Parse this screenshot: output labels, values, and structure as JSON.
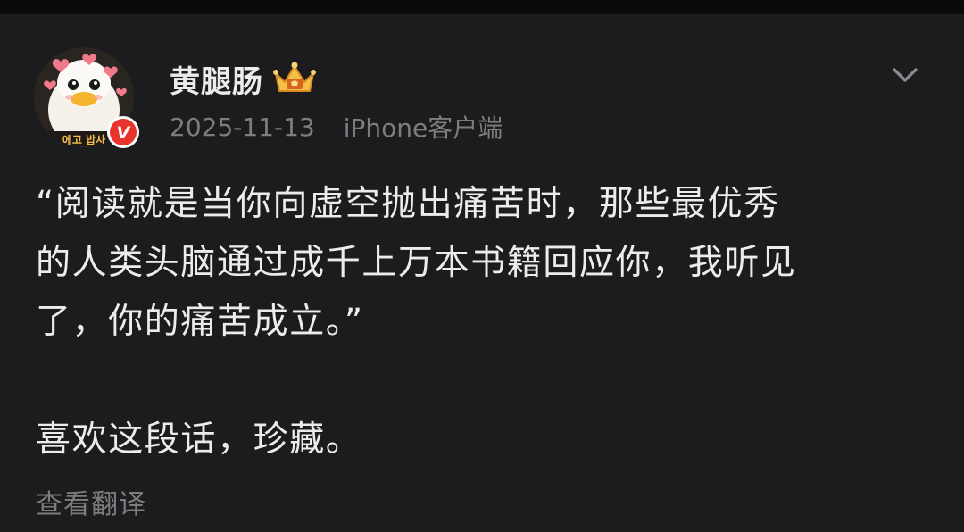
{
  "post": {
    "author": {
      "name": "黄腿肠",
      "avatar_icon": "duck-avatar-with-hearts",
      "avatar_caption": "에고 밥사",
      "badge_icon": "vip-crown-icon",
      "verified_icon": "verified-v-badge",
      "verified_mark": "V"
    },
    "date": "2025-11-13",
    "source": "iPhone客户端",
    "content_lines": [
      "“阅读就是当你向虚空抛出痛苦时，那些最优秀",
      "的人类头脑通过成千上万本书籍回应你，我听见",
      "了，你的痛苦成立。”",
      "喜欢这段话，珍藏。"
    ],
    "translate_label": "查看翻译",
    "more_icon": "chevron-down-icon"
  },
  "colors": {
    "background": "#1c1c1e",
    "primary_text": "#ececec",
    "secondary_text": "#7d7d80",
    "verified_badge": "#e8332c",
    "crown_gold": "#f3c14a"
  }
}
